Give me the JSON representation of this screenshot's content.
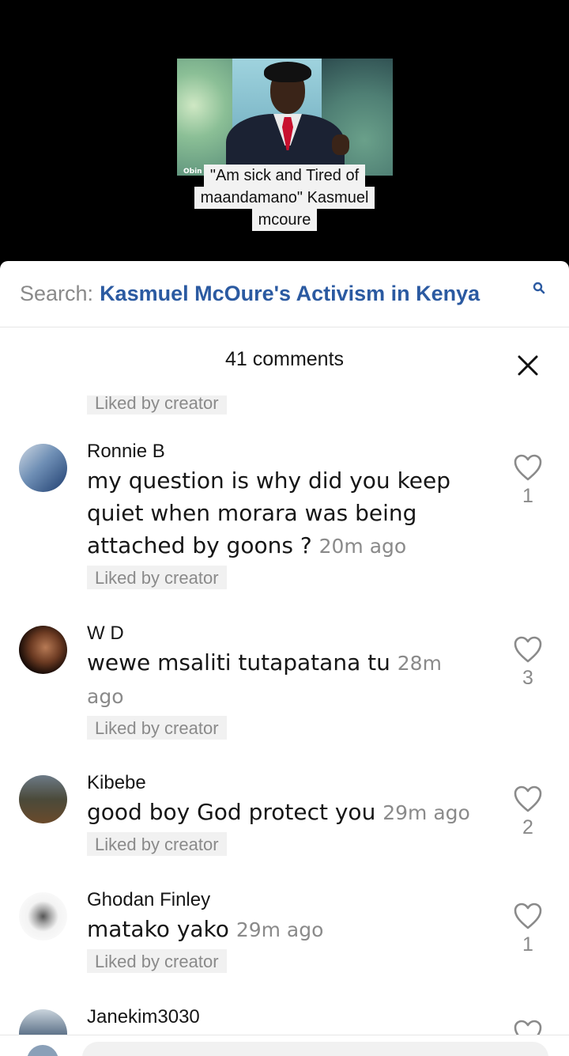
{
  "video": {
    "watermark": "Obin",
    "caption_lines": [
      "\"Am sick and Tired of",
      "maandamano\" Kasmuel",
      "mcoure"
    ]
  },
  "search": {
    "prefix": "Search:",
    "query": "Kasmuel McOure's Activism in Kenya",
    "icon": "search-icon"
  },
  "comments_header": {
    "count_label": "41 comments",
    "close_icon": "close-icon"
  },
  "comments": {
    "top_badge": "Liked by creator",
    "items": [
      {
        "username": "Ronnie B",
        "text": "my question is why did you keep quiet when morara was being attached by goons ?",
        "time": "20m ago",
        "badge": "Liked by creator",
        "likes": "1"
      },
      {
        "username": "W D",
        "text": "wewe msaliti tutapatana tu",
        "time": "28m ago",
        "badge": "Liked by creator",
        "likes": "3"
      },
      {
        "username": "Kibebe",
        "text": "good boy God protect you",
        "time": "29m ago",
        "badge": "Liked by creator",
        "likes": "2"
      },
      {
        "username": "Ghodan Finley",
        "text": "matako yako",
        "time": "29m ago",
        "badge": "Liked by creator",
        "likes": "1"
      },
      {
        "username": "Janekim3030",
        "text": "",
        "time": "",
        "badge": "",
        "likes": ""
      }
    ]
  },
  "colors": {
    "accent": "#2b5aa1",
    "muted": "#8a8a8a",
    "badge_bg": "#f1f1f1",
    "text": "#161616"
  }
}
